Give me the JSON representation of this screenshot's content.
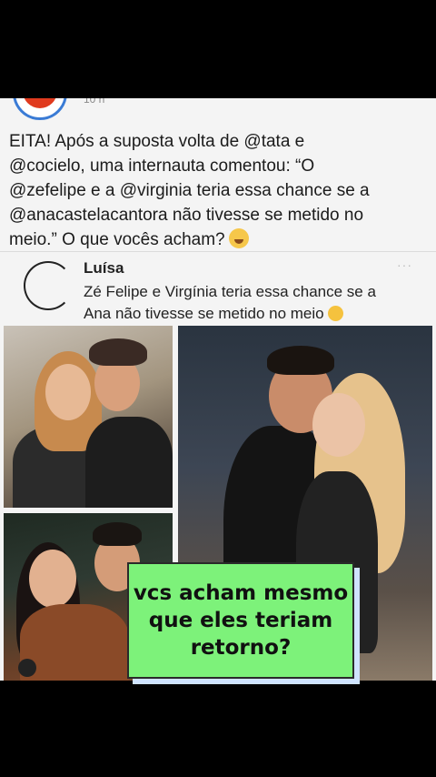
{
  "post": {
    "timestamp": "10 h",
    "caption_lines": [
      "EITA! Após a suposta volta de @tata e",
      "@cocielo, uma internauta comentou: “O",
      "@zefelipe e a @virginia teria essa chance se a",
      "@anacastelacantora não tivesse se metido no",
      "meio.” O que vocês acham?"
    ],
    "caption_emoji": "flushed-face-emoji"
  },
  "quoted": {
    "name": "Luísa",
    "dots": "···",
    "text_lines": [
      "Zé Felipe e Virgínia teria essa chance se a",
      "Ana não tivesse se metido no meio"
    ],
    "text_emoji": "smiling-face-emoji"
  },
  "overlay": {
    "lines": [
      "vcs acham mesmo",
      "que eles teriam",
      "retorno?"
    ],
    "background_color": "#7df27a"
  }
}
